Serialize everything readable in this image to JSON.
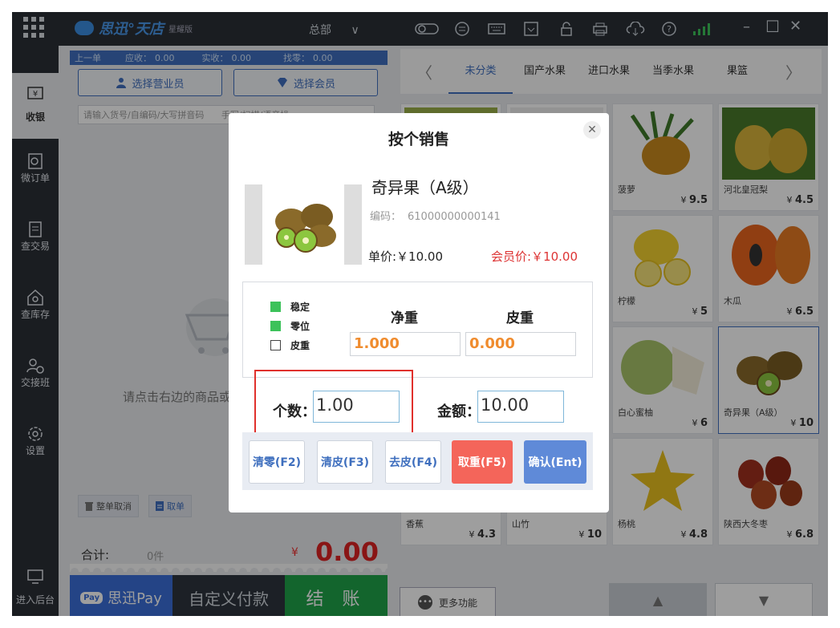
{
  "nav": {
    "items": [
      {
        "label": "收银",
        "icon": "cash-register-icon"
      },
      {
        "label": "微订单",
        "icon": "micro-order-icon"
      },
      {
        "label": "查交易",
        "icon": "transaction-icon"
      },
      {
        "label": "查库存",
        "icon": "inventory-icon"
      },
      {
        "label": "交接班",
        "icon": "shift-handover-icon"
      },
      {
        "label": "设置",
        "icon": "gear-icon"
      }
    ],
    "backend": "进入后台"
  },
  "topbar": {
    "brand": "思迅°天店",
    "edition": "星耀版",
    "store": "总部",
    "caret": "∨",
    "window_controls": [
      "–",
      "☐",
      "✕"
    ]
  },
  "order": {
    "prev": "上一单",
    "receivable_label": "应收：",
    "receivable": "0.00",
    "received_label": "实收：",
    "received": "0.00",
    "change_label": "找零：",
    "change": "0.00",
    "select_staff": "选择营业员",
    "select_member": "选择会员",
    "search_placeholder": "请输入货号/自编码/大写拼音码",
    "search_hint": "手写/扫描/语音操",
    "empty_hint": "请点击右边的商品或",
    "cancel_all": "整单取消",
    "take_order": "取单",
    "total_label": "合计:",
    "total_count": "0件",
    "currency": "¥",
    "total_amount": "0.00"
  },
  "pay": {
    "badge": "Pay",
    "sixun_pay": "思迅Pay",
    "custom_pay": "自定义付款",
    "checkout": "结 账"
  },
  "categories": {
    "prev": "〈",
    "next": "〉",
    "items": [
      "未分类",
      "国产水果",
      "进口水果",
      "当季水果",
      "果篮"
    ]
  },
  "products": [
    {
      "name": "菠萝",
      "price": "9.5"
    },
    {
      "name": "河北皇冠梨",
      "price": "4.5"
    },
    {
      "name": "柠檬",
      "price": "5"
    },
    {
      "name": "木瓜",
      "price": "6.5"
    },
    {
      "name": "白心蜜柚",
      "price": "6"
    },
    {
      "name": "奇异果（A级）",
      "price": "10"
    },
    {
      "name": "香蕉",
      "price": "4.3"
    },
    {
      "name": "山竹",
      "price": "10"
    },
    {
      "name": "杨桃",
      "price": "4.8"
    },
    {
      "name": "陕西大冬枣",
      "price": "6.8"
    }
  ],
  "more_functions": "更多功能",
  "dialog": {
    "title": "按个销售",
    "close": "✕",
    "product_name": "奇异果（A级）",
    "code_label": "编码：",
    "code": "61000000000141",
    "unit_price": "单价:￥10.00",
    "member_price": "会员价:￥10.00",
    "stable": "稳定",
    "zero": "零位",
    "tare": "皮重",
    "net_weight_label": "净重",
    "tare_weight_label": "皮重",
    "net_weight": "1.000",
    "tare_weight": "0.000",
    "quantity_label": "个数：",
    "quantity": "1.00",
    "amount_label": "金额：",
    "amount": "10.00",
    "buttons": {
      "clear_zero": "清零(F2)",
      "clear_tare": "清皮(F3)",
      "set_tare": "去皮(F4)",
      "take_weight": "取重(F5)",
      "confirm": "确认(Ent)"
    }
  },
  "colors": {
    "accent": "#3f6fbe",
    "nav_bg": "#2a2f36",
    "checkout": "#1fa34a",
    "price_red": "#d22222",
    "weight_orange": "#f08c2e",
    "highlight_red": "#e0302c"
  }
}
